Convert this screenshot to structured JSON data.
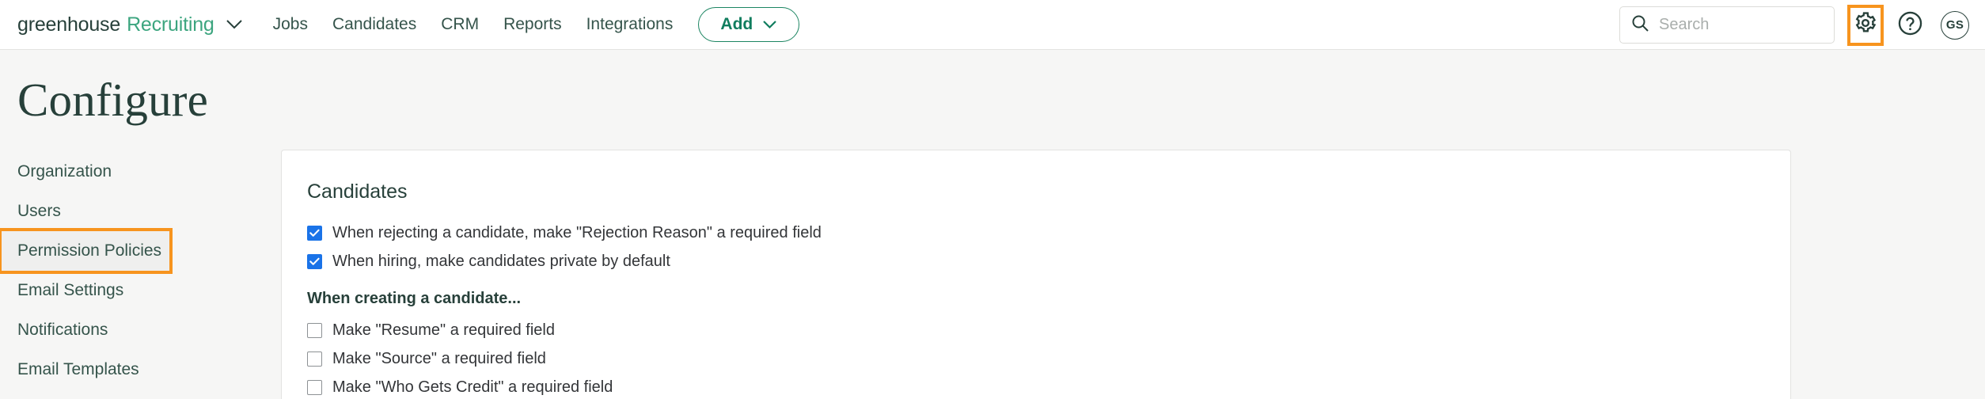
{
  "header": {
    "brand_primary": "greenhouse",
    "brand_secondary": "Recruiting",
    "brand_caret_icon": "chevron-down-icon",
    "nav": [
      {
        "label": "Jobs"
      },
      {
        "label": "Candidates"
      },
      {
        "label": "CRM"
      },
      {
        "label": "Reports"
      },
      {
        "label": "Integrations"
      }
    ],
    "add_button": {
      "label": "Add",
      "caret_icon": "chevron-down-icon"
    },
    "search": {
      "placeholder": "Search",
      "value": "",
      "icon": "search-icon"
    },
    "settings_icon": "gear-icon",
    "help_icon": "question-mark-circle-icon",
    "avatar_initials": "GS"
  },
  "page": {
    "title": "Configure"
  },
  "sidebar": {
    "items": [
      {
        "label": "Organization",
        "selected": false
      },
      {
        "label": "Users",
        "selected": false
      },
      {
        "label": "Permission Policies",
        "selected": true
      },
      {
        "label": "Email Settings",
        "selected": false
      },
      {
        "label": "Notifications",
        "selected": false
      },
      {
        "label": "Email Templates",
        "selected": false
      }
    ]
  },
  "main": {
    "section_title": "Candidates",
    "checkboxes_top": [
      {
        "label": "When rejecting a candidate, make \"Rejection Reason\" a required field",
        "checked": true
      },
      {
        "label": "When hiring, make candidates private by default",
        "checked": true
      }
    ],
    "group_label": "When creating a candidate...",
    "checkboxes_group": [
      {
        "label": "Make \"Resume\" a required field",
        "checked": false
      },
      {
        "label": "Make \"Source\" a required field",
        "checked": false
      },
      {
        "label": "Make \"Who Gets Credit\" a required field",
        "checked": false
      }
    ]
  },
  "colors": {
    "brand_green": "#3ca57f",
    "dark_green": "#27403a",
    "highlight_orange": "#f7941e",
    "checkbox_blue": "#1a73e8",
    "page_bg": "#f6f6f5"
  }
}
